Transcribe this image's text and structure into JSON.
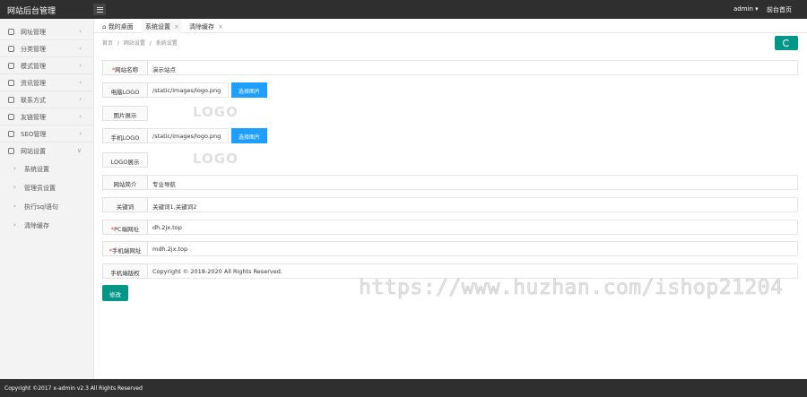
{
  "header": {
    "brand": "网站后台管理",
    "user": "admin ▾",
    "frontpage": "前台首页"
  },
  "sidebar": {
    "items": [
      {
        "label": "网址管理",
        "icon": "globe-icon",
        "chevron": "‹"
      },
      {
        "label": "分类管理",
        "icon": "grid-icon",
        "chevron": "‹"
      },
      {
        "label": "模式管理",
        "icon": "list-icon",
        "chevron": "‹"
      },
      {
        "label": "资讯管理",
        "icon": "document-icon",
        "chevron": "‹"
      },
      {
        "label": "联系方式",
        "icon": "phone-icon",
        "chevron": "‹"
      },
      {
        "label": "友链管理",
        "icon": "link-icon",
        "chevron": "‹"
      },
      {
        "label": "SEO管理",
        "icon": "seo-icon",
        "chevron": "‹"
      },
      {
        "label": "网站设置",
        "icon": "gear-icon",
        "chevron": "∨"
      }
    ],
    "subitems": [
      {
        "label": "系统设置"
      },
      {
        "label": "管理员设置"
      },
      {
        "label": "执行sql语句"
      },
      {
        "label": "清除缓存"
      }
    ]
  },
  "tabs": [
    {
      "label": "我的桌面",
      "icon": "home-icon"
    },
    {
      "label": "系统设置",
      "close": "×"
    },
    {
      "label": "清除缓存",
      "close": "×"
    }
  ],
  "breadcrumb": [
    "首页",
    "/",
    "网站设置",
    "/",
    "系统设置"
  ],
  "form": {
    "site_name": {
      "label": "网站名称",
      "required": "*",
      "value": "演示站点"
    },
    "pc_logo": {
      "label": "电脑LOGO",
      "value": "/static/images/logo.png",
      "button": "选择图片"
    },
    "pc_logo_preview": {
      "label": "图片展示",
      "image_text": "LOGO"
    },
    "mobile_logo": {
      "label": "手机LOGO",
      "value": "/static/images/logo.png",
      "button": "选择图片"
    },
    "mobile_logo_preview": {
      "label": "LOGO展示",
      "image_text": "LOGO"
    },
    "site_intro": {
      "label": "网站简介",
      "value": "专业导航"
    },
    "keywords": {
      "label": "关键词",
      "value": "关键词1,关键词2"
    },
    "pc_domain": {
      "label": "PC端网址",
      "required": "*",
      "value": "dh.2jx.top"
    },
    "mobile_domain": {
      "label": "手机端网址",
      "required": "*",
      "value": "mdh.2jx.top"
    },
    "copyright": {
      "label": "手机端版权",
      "value": "Copyright © 2018-2020 All Rights Reserved."
    },
    "submit": "修改"
  },
  "watermark": "https://www.huzhan.com/ishop21204",
  "footer": "Copyright ©2017 x-admin v2.3 All Rights Reserved",
  "colors": {
    "primary": "#009688",
    "upload": "#1e9fff",
    "topbar": "#2f2f2f"
  }
}
